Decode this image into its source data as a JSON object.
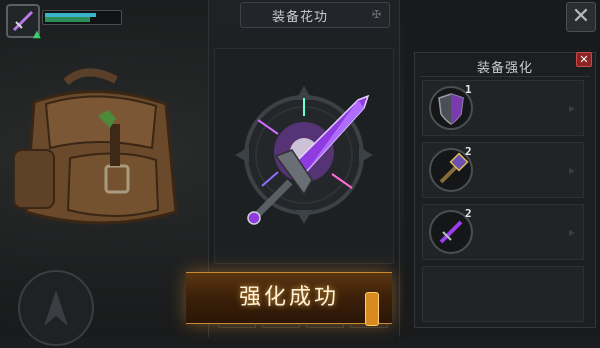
{
  "left": {
    "player_hp_fraction": 0.58,
    "player_mp_fraction": 0.65
  },
  "center": {
    "title": "装备花功",
    "header_icon": "emblem-icon",
    "result_banner": "强化成功"
  },
  "right": {
    "panel_title": "装备强化",
    "enhance_items": [
      {
        "icon": "shield-icon",
        "level": "1"
      },
      {
        "icon": "hammer-icon",
        "level": "2"
      },
      {
        "icon": "sword-icon",
        "level": "2"
      }
    ],
    "empty_row": true
  },
  "colors": {
    "banner_gold": "#c98a32",
    "hp_green": "#2c8f5a",
    "mp_cyan": "#3bb3c9",
    "sword_purple": "#9b3cf0",
    "close_red": "#8c2424"
  }
}
